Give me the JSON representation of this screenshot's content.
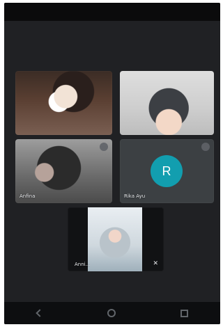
{
  "call": {
    "participants": [
      {
        "type": "video",
        "name": ""
      },
      {
        "type": "video",
        "name": ""
      },
      {
        "type": "video",
        "name": "Anfina"
      },
      {
        "type": "avatar",
        "name": "Rika Ayu",
        "initial": "R",
        "avatar_color": "#129eaf"
      },
      {
        "type": "video",
        "name": "Anni..."
      }
    ]
  }
}
